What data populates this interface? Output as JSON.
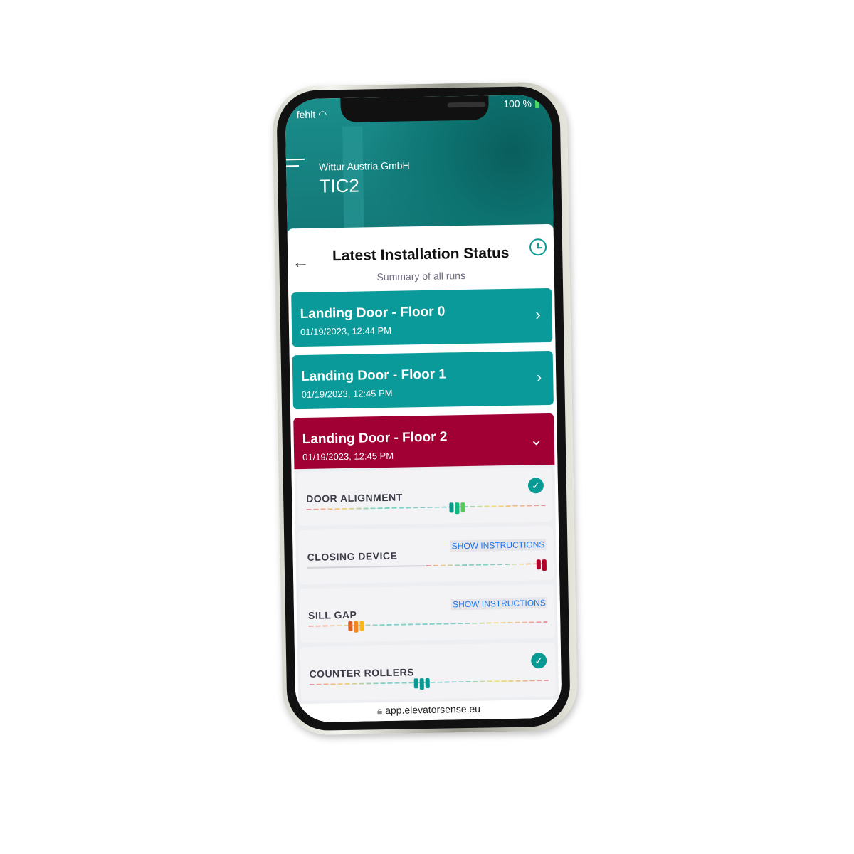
{
  "status_bar": {
    "carrier": "fehlt",
    "battery": "100 %"
  },
  "header": {
    "company": "Wittur Austria GmbH",
    "app": "TIC2"
  },
  "page": {
    "title": "Latest Installation Status",
    "subtitle": "Summary of all runs"
  },
  "runs": [
    {
      "name": "Landing Door - Floor 0",
      "date": "01/19/2023, 12:44 PM",
      "state": "collapsed",
      "color": "#0a9a9a"
    },
    {
      "name": "Landing Door - Floor 1",
      "date": "01/19/2023, 12:45 PM",
      "state": "collapsed",
      "color": "#0a9a9a"
    },
    {
      "name": "Landing Door - Floor 2",
      "date": "01/19/2023, 12:45 PM",
      "state": "expanded",
      "color": "#a00034"
    }
  ],
  "checks": [
    {
      "label": "DOOR ALIGNMENT",
      "status": "ok",
      "marker_position": 0.63,
      "marker_colors": [
        "#0a9a8a",
        "#10b880",
        "#5cc860"
      ]
    },
    {
      "label": "CLOSING DEVICE",
      "status": "fail",
      "action": "SHOW INSTRUCTIONS",
      "marker_position": 0.98,
      "marker_colors": [
        "#b0002a",
        "#b0002a"
      ]
    },
    {
      "label": "SILL GAP",
      "status": "fail",
      "action": "SHOW INSTRUCTIONS",
      "marker_position": 0.2,
      "marker_colors": [
        "#e0602a",
        "#f08a20",
        "#f8b820"
      ]
    },
    {
      "label": "COUNTER ROLLERS",
      "status": "ok",
      "marker_position": 0.47,
      "marker_colors": [
        "#0a9a94",
        "#0a9a94",
        "#0a9a94"
      ]
    }
  ],
  "browser": {
    "url": "app.elevatorsense.eu"
  },
  "colors": {
    "accent": "#0a9a94",
    "alert": "#a00034",
    "link": "#1877f2"
  }
}
